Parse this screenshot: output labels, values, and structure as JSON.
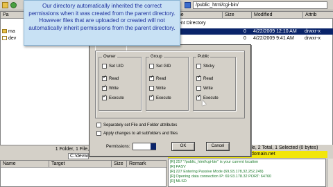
{
  "tooltip": {
    "text": "Our directory automatically inherited the correct permissions when it was created from the parent directory. However files that are uploaded or created will not automatically inherit permissions from the parent directory."
  },
  "toolbar": {
    "remote_path": "/public_html/cgi-bin/",
    "local_path": "Pa"
  },
  "left_pane": {
    "rows": [
      {
        "name": "ma"
      },
      {
        "name": "dev"
      }
    ]
  },
  "right_pane": {
    "columns": [
      "Name",
      "Size",
      "Modified",
      "Attrib"
    ],
    "info_row": "ent Directory",
    "rows": [
      {
        "name": "",
        "size": "0",
        "modified": "4/22/2009 12:10 AM",
        "attrib": "drwxr-x"
      },
      {
        "name": "",
        "size": "0",
        "modified": "4/22/2009 9:41 AM",
        "attrib": "drwxr-x"
      }
    ]
  },
  "dialog": {
    "groups": [
      {
        "title": "Owner",
        "items": [
          {
            "label": "Set UID",
            "checked": false
          },
          {
            "label": "Read",
            "checked": true
          },
          {
            "label": "Write",
            "checked": true
          },
          {
            "label": "Execute",
            "checked": true
          }
        ]
      },
      {
        "title": "Group",
        "items": [
          {
            "label": "Set GID",
            "checked": false
          },
          {
            "label": "Read",
            "checked": true
          },
          {
            "label": "Write",
            "checked": false
          },
          {
            "label": "Execute",
            "checked": true
          }
        ]
      },
      {
        "title": "Public",
        "items": [
          {
            "label": "Sticky",
            "checked": false
          },
          {
            "label": "Read",
            "checked": true
          },
          {
            "label": "Write",
            "checked": false
          },
          {
            "label": "Execute",
            "checked": true
          }
        ]
      }
    ],
    "options": [
      {
        "label": "Separately set File and Folder attributes",
        "checked": false
      },
      {
        "label": "Apply changes to all subfolders and files",
        "checked": false
      }
    ],
    "permissions_label": "Permissions:",
    "permissions_value": "",
    "ok_label": "OK",
    "cancel_label": "Cancel"
  },
  "status": {
    "left": "1 Folder, 1 File, 2 Total 12",
    "left_address": "C:\\devwi",
    "right": "1 Folder, 1 File, 2 Total, 1 Selected (0 bytes)",
    "yellow": "domain.net"
  },
  "queue": {
    "columns": [
      "Name",
      "Target",
      "Size",
      "Remark"
    ]
  },
  "log": [
    "[R] 257 \"/public_html/cgi-bin\" is your current location",
    "[R] PASV",
    "[R] 227 Entering Passive Mode (69,93,178,32,252,249)",
    "[R] Opening data connection IP: 69.93.178.32 PORT: 64760",
    "[R] MLSD"
  ],
  "colors": {
    "tooltip_bg": "#c8e1f4",
    "tooltip_text": "#1c2f9e",
    "log_text": "#1a7a2a",
    "status_yellow": "#f2e60a"
  }
}
